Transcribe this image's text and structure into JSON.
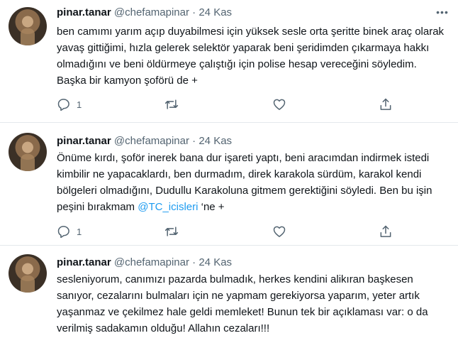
{
  "tweets": [
    {
      "name": "pinar.tanar",
      "handle": "@chefamapinar",
      "sep": "·",
      "date": "24 Kas",
      "text": "ben camımı yarım açıp duyabilmesi için yüksek sesle orta şeritte binek araç olarak yavaş gittiğimi, hızla gelerek selektör yaparak beni şeridimden çıkarmaya hakkı olmadığını ve beni öldürmeye çalıştığı için polise hesap vereceğini söyledim. Başka bir kamyon şoförü de +",
      "reply_count": "1"
    },
    {
      "name": "pinar.tanar",
      "handle": "@chefamapinar",
      "sep": "·",
      "date": "24 Kas",
      "text_before": "Önüme kırdı, şoför inerek bana dur işareti yaptı, beni aracımdan indirmek istedi kimbilir ne yapacaklardı, ben durmadım, direk karakola sürdüm, karakol kendi bölgeleri olmadığını, Dudullu Karakoluna gitmem gerektiğini söyledi. Ben bu işin peşini bırakmam ",
      "mention": "@TC_icisleri",
      "text_after": " ‘ne +",
      "reply_count": "1"
    },
    {
      "name": "pinar.tanar",
      "handle": "@chefamapinar",
      "sep": "·",
      "date": "24 Kas",
      "text": "sesleniyorum, canımızı pazarda bulmadık, herkes kendini alikıran başkesen sanıyor, cezalarını bulmaları için ne yapmam gerekiyorsa yaparım, yeter artık yaşanmaz ve çekilmez hale geldi memleket! Bunun tek bir açıklaması var: o da verilmiş sadakamın olduğu! Allahın cezaları!!!"
    }
  ],
  "icons": {
    "reply": "reply-icon",
    "retweet": "retweet-icon",
    "like": "like-icon",
    "share": "share-icon",
    "more": "more-icon"
  },
  "colors": {
    "link": "#1d9bf0",
    "secondary_text": "#536471",
    "divider": "#e4e9ec"
  }
}
